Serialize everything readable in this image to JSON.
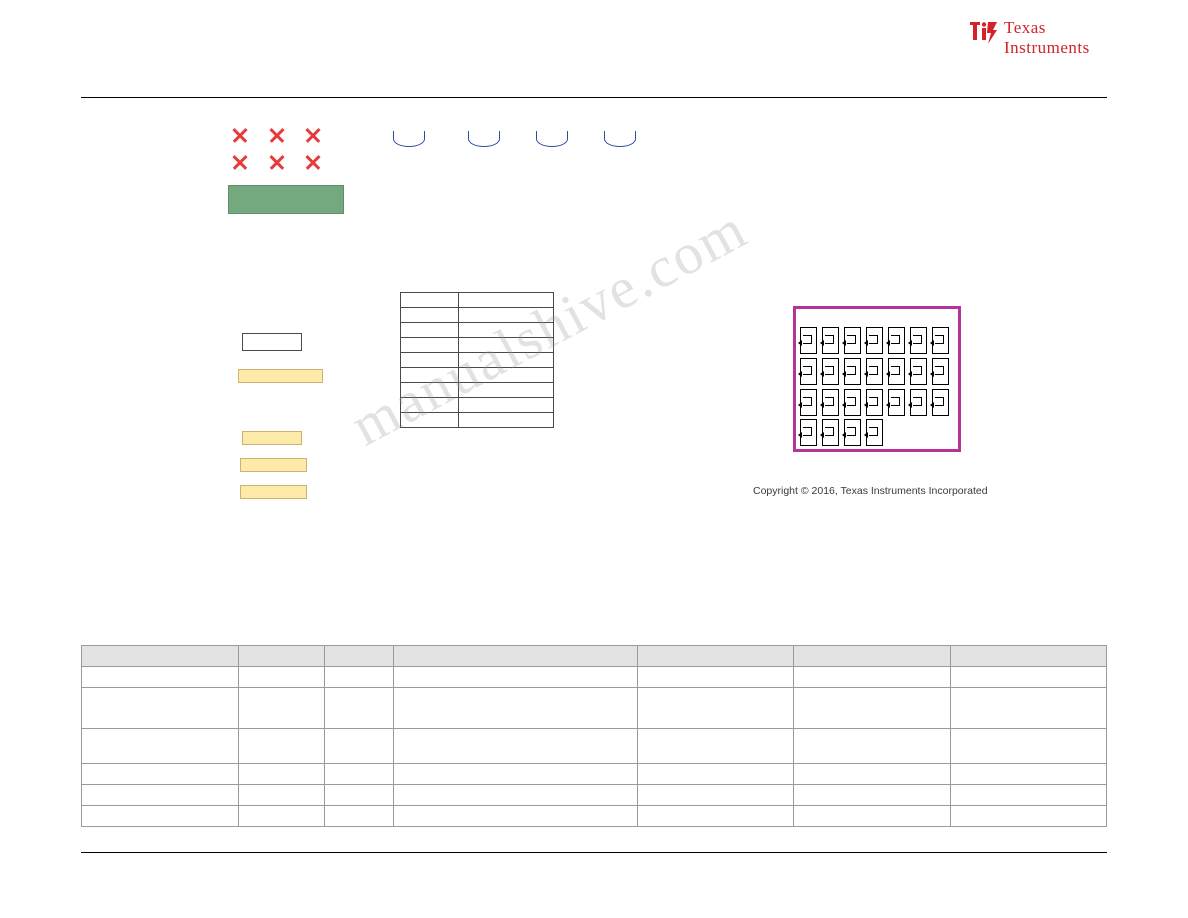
{
  "logo": {
    "line1": "Texas",
    "line1_small": "EXAS",
    "line2": "Instruments",
    "line2_small": "NSTRUMENTS",
    "symbol_name": "ti-logo-symbol"
  },
  "schematic": {
    "x_marks_name": "component-x-marker",
    "arcs_name": "component-arc-symbol",
    "green_box_name": "green-highlight-block",
    "white_box_name": "white-component-block",
    "yellow_bars_name": "yellow-highlight-bar",
    "mini_table_rows": 9,
    "mini_table_cols": 2,
    "ic_block_name": "ic-pin-array-block",
    "pin_rows": [
      7,
      7,
      7,
      4
    ],
    "copyright": "Copyright © 2016, Texas Instruments Incorporated",
    "ic_border_color": "#b5339a",
    "green_color": "#74a87f",
    "yellow_color": "#fde9a8",
    "x_color": "#e8393c",
    "arc_color": "#2b4fa2"
  },
  "watermark": {
    "text": "manualshive.com"
  },
  "bom": {
    "headers": [
      "",
      "",
      "",
      "",
      "",
      "",
      ""
    ],
    "rows": [
      {
        "cells": [
          "",
          "",
          "",
          "",
          "",
          "",
          ""
        ],
        "height": "normal"
      },
      {
        "cells": [
          "",
          "",
          "",
          "",
          "",
          "",
          ""
        ],
        "height": "tall"
      },
      {
        "cells": [
          "",
          "",
          "",
          "",
          "",
          "",
          ""
        ],
        "height": "tall2"
      },
      {
        "cells": [
          "",
          "",
          "",
          "",
          "",
          "",
          ""
        ],
        "height": "normal"
      },
      {
        "cells": [
          "",
          "",
          "",
          "",
          "",
          "",
          ""
        ],
        "height": "normal"
      },
      {
        "cells": [
          "",
          "",
          "",
          "",
          "",
          "",
          ""
        ],
        "height": "normal"
      }
    ]
  }
}
